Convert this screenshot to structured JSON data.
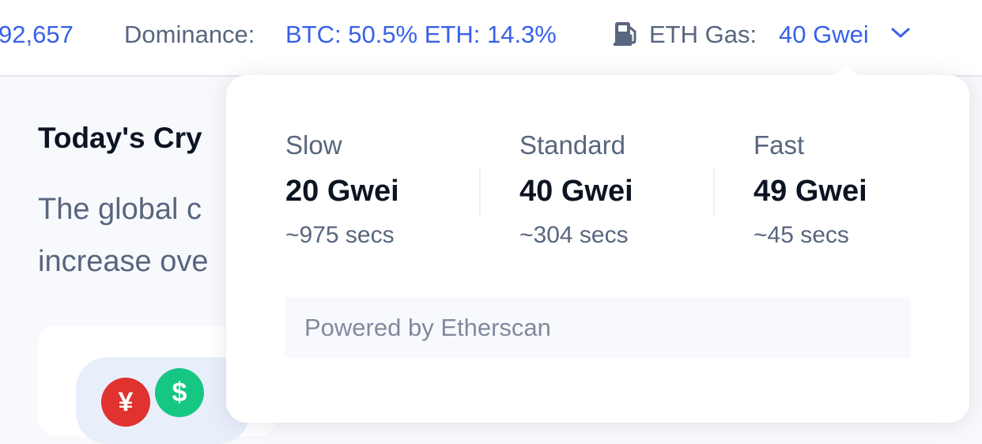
{
  "topbar": {
    "volume_partial": "92,657",
    "dominance_label": "Dominance:",
    "dominance_value": "BTC: 50.5% ETH: 14.3%",
    "gas_label": "ETH Gas:",
    "gas_value": "40 Gwei",
    "gas_icon": "gas-pump-icon",
    "dropdown_icon": "chevron-down-icon"
  },
  "main": {
    "title_partial": "Today's Cry",
    "desc_line1_partial": "The global c",
    "desc_line2_partial": "increase ove",
    "card_icons": {
      "yen_glyph": "¥",
      "usd_glyph": "$"
    }
  },
  "gas_popup": {
    "tiers": [
      {
        "label": "Slow",
        "value": "20 Gwei",
        "time": "~975 secs"
      },
      {
        "label": "Standard",
        "value": "40 Gwei",
        "time": "~304 secs"
      },
      {
        "label": "Fast",
        "value": "49 Gwei",
        "time": "~45 secs"
      }
    ],
    "footer": "Powered by Etherscan"
  },
  "colors": {
    "accent": "#3861e8",
    "muted_text": "#58667e",
    "dark_text": "#0d1421",
    "yen_coin": "#e0322f",
    "usd_coin": "#16c784"
  }
}
